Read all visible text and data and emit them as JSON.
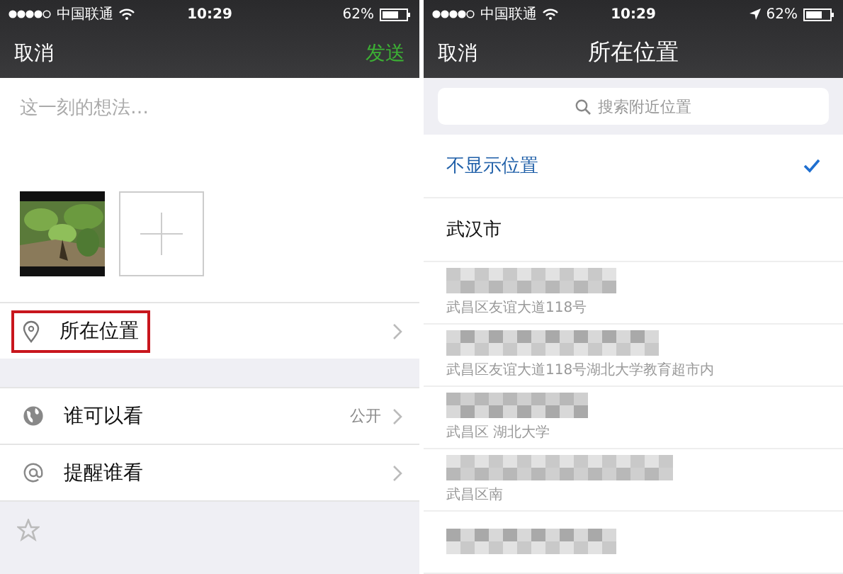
{
  "screens": [
    {
      "status_bar": {
        "carrier": "中国联通",
        "time": "10:29",
        "battery": "62%"
      },
      "nav": {
        "left": "取消",
        "right": "发送"
      },
      "post": {
        "placeholder": "这一刻的想法…"
      },
      "rows": [
        {
          "kind": "location",
          "label": "所在位置",
          "highlighted": true
        },
        {
          "kind": "globe",
          "label": "谁可以看",
          "value": "公开",
          "highlighted": false,
          "gap_before": true
        },
        {
          "kind": "mention",
          "label": "提醒谁看",
          "highlighted": false
        }
      ]
    },
    {
      "status_bar": {
        "carrier": "中国联通",
        "time": "10:29",
        "battery": "62%",
        "location_on": true
      },
      "nav": {
        "left": "取消",
        "title": "所在位置"
      },
      "search": {
        "placeholder": "搜索附近位置"
      },
      "options": [
        {
          "label": "不显示位置",
          "selected": true
        },
        {
          "label": "武汉市",
          "selected": false
        }
      ],
      "places": [
        {
          "kind": "address",
          "address": "武昌区友谊大道118号"
        },
        {
          "kind": "address",
          "address": "武昌区友谊大道118号湖北大学教育超市内"
        },
        {
          "kind": "address",
          "address": "武昌区 湖北大学"
        },
        {
          "kind": "address",
          "address": "武昌区南"
        },
        {
          "kind": "name-only"
        }
      ]
    }
  ]
}
